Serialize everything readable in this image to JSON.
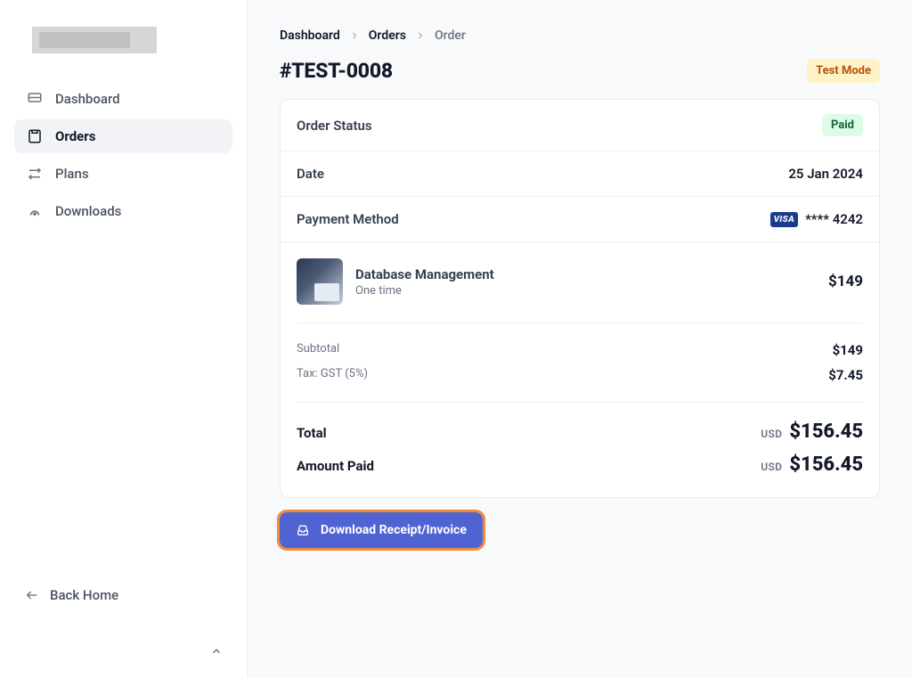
{
  "sidebar": {
    "items": [
      {
        "label": "Dashboard"
      },
      {
        "label": "Orders"
      },
      {
        "label": "Plans"
      },
      {
        "label": "Downloads"
      }
    ],
    "back_label": "Back Home"
  },
  "breadcrumb": {
    "dashboard": "Dashboard",
    "orders": "Orders",
    "current": "Order"
  },
  "page": {
    "title": "#TEST-0008",
    "mode_badge": "Test Mode"
  },
  "order": {
    "status_label": "Order Status",
    "status_value": "Paid",
    "date_label": "Date",
    "date_value": "25 Jan 2024",
    "pm_label": "Payment Method",
    "pm_brand": "VISA",
    "pm_last4": "**** 4242"
  },
  "line_item": {
    "name": "Database Management",
    "sub": "One time",
    "price": "$149"
  },
  "summary": {
    "subtotal_label": "Subtotal",
    "subtotal_value": "$149",
    "tax_label": "Tax: GST (5%)",
    "tax_value": "$7.45"
  },
  "totals": {
    "total_label": "Total",
    "amount_paid_label": "Amount Paid",
    "currency": "USD",
    "total_value": "$156.45",
    "amount_paid_value": "$156.45"
  },
  "actions": {
    "download_label": "Download Receipt/Invoice"
  }
}
